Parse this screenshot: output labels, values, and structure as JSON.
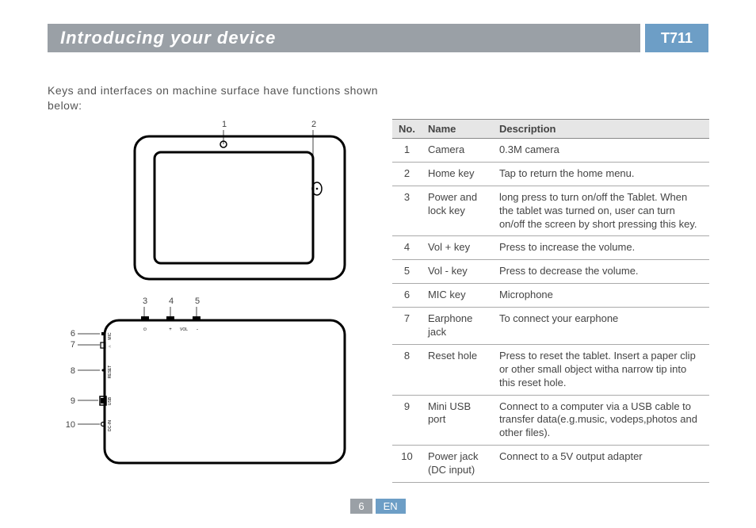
{
  "header": {
    "title": "Introducing your device",
    "code": "T711"
  },
  "intro": "Keys and interfaces on machine surface have functions shown below:",
  "diagram": {
    "top_labels": {
      "l1": "1",
      "l2": "2"
    },
    "mid_labels": {
      "l3": "3",
      "l4": "4",
      "l5": "5"
    },
    "side_labels": {
      "l6": "6",
      "l7": "7",
      "l8": "8",
      "l9": "9",
      "l10": "10"
    },
    "port_labels": {
      "mic": "MIC",
      "earphone": "",
      "plus": "+",
      "vol": "VOL",
      "minus": "-",
      "reset": "RESET",
      "usb": "USB",
      "dcin": "DC-IN"
    }
  },
  "table": {
    "headers": {
      "no": "No.",
      "name": "Name",
      "desc": "Description"
    },
    "rows": [
      {
        "no": "1",
        "name": "Camera",
        "desc": "0.3M camera"
      },
      {
        "no": "2",
        "name": "Home key",
        "desc": "Tap to return the home menu."
      },
      {
        "no": "3",
        "name": "Power and lock key",
        "desc": "long press to turn on/off the Tablet. When the tablet was turned on, user can turn on/off the screen by short pressing this key."
      },
      {
        "no": "4",
        "name": "Vol + key",
        "desc": "Press to increase the volume."
      },
      {
        "no": "5",
        "name": "Vol - key",
        "desc": "Press to decrease the volume."
      },
      {
        "no": "6",
        "name": "MIC key",
        "desc": "Microphone"
      },
      {
        "no": "7",
        "name": "Earphone jack",
        "desc": "To connect your earphone"
      },
      {
        "no": "8",
        "name": "Reset hole",
        "desc": "Press to reset the tablet. Insert a paper clip or other small object witha narrow tip into this reset hole."
      },
      {
        "no": "9",
        "name": "Mini USB port",
        "desc": "Connect to a computer via a USB cable to transfer data(e.g.music, vodeps,photos and other files)."
      },
      {
        "no": "10",
        "name": "Power jack (DC input)",
        "desc": "Connect to a 5V output adapter"
      }
    ]
  },
  "footer": {
    "page": "6",
    "lang": "EN"
  }
}
